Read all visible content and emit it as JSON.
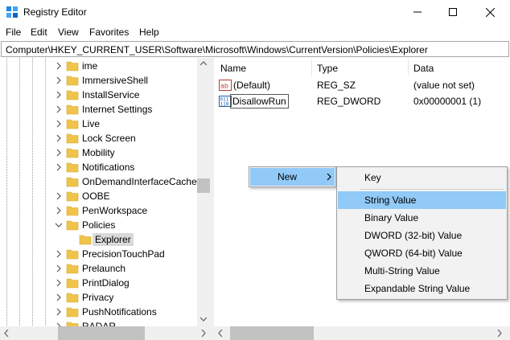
{
  "window": {
    "title": "Registry Editor",
    "icon": "regedit-icon",
    "controls": [
      "minimize-icon",
      "maximize-icon",
      "close-icon"
    ]
  },
  "menu": [
    "File",
    "Edit",
    "View",
    "Favorites",
    "Help"
  ],
  "address": "Computer\\HKEY_CURRENT_USER\\Software\\Microsoft\\Windows\\CurrentVersion\\Policies\\Explorer",
  "tree": {
    "items": [
      {
        "label": "ime",
        "expander": "collapsed"
      },
      {
        "label": "ImmersiveShell",
        "expander": "collapsed"
      },
      {
        "label": "InstallService",
        "expander": "collapsed"
      },
      {
        "label": "Internet Settings",
        "expander": "collapsed"
      },
      {
        "label": "Live",
        "expander": "collapsed"
      },
      {
        "label": "Lock Screen",
        "expander": "collapsed"
      },
      {
        "label": "Mobility",
        "expander": "collapsed"
      },
      {
        "label": "Notifications",
        "expander": "collapsed"
      },
      {
        "label": "OnDemandInterfaceCache",
        "expander": "none"
      },
      {
        "label": "OOBE",
        "expander": "collapsed"
      },
      {
        "label": "PenWorkspace",
        "expander": "collapsed"
      },
      {
        "label": "Policies",
        "expander": "expanded"
      },
      {
        "label": "Explorer",
        "expander": "none",
        "child": true,
        "selected": true
      },
      {
        "label": "PrecisionTouchPad",
        "expander": "collapsed"
      },
      {
        "label": "Prelaunch",
        "expander": "collapsed"
      },
      {
        "label": "PrintDialog",
        "expander": "collapsed"
      },
      {
        "label": "Privacy",
        "expander": "collapsed"
      },
      {
        "label": "PushNotifications",
        "expander": "collapsed"
      },
      {
        "label": "RADAR",
        "expander": "collapsed"
      }
    ]
  },
  "list": {
    "columns": [
      "Name",
      "Type",
      "Data"
    ],
    "rows": [
      {
        "icon": "string-value-icon",
        "name": "(Default)",
        "type": "REG_SZ",
        "data": "(value not set)"
      },
      {
        "icon": "binary-value-icon",
        "name": "DisallowRun",
        "type": "REG_DWORD",
        "data": "0x00000001 (1)",
        "editing": true
      }
    ]
  },
  "context_menu": {
    "parent_label": "New",
    "items": [
      "Key",
      "String Value",
      "Binary Value",
      "DWORD (32-bit) Value",
      "QWORD (64-bit) Value",
      "Multi-String Value",
      "Expandable String Value"
    ],
    "highlighted_index": 1
  },
  "colors": {
    "folder": "#f0c44a",
    "menu_highlight": "#91c9f7",
    "menu_bg": "#f2f2f2",
    "selection": "#d9d9d9"
  }
}
